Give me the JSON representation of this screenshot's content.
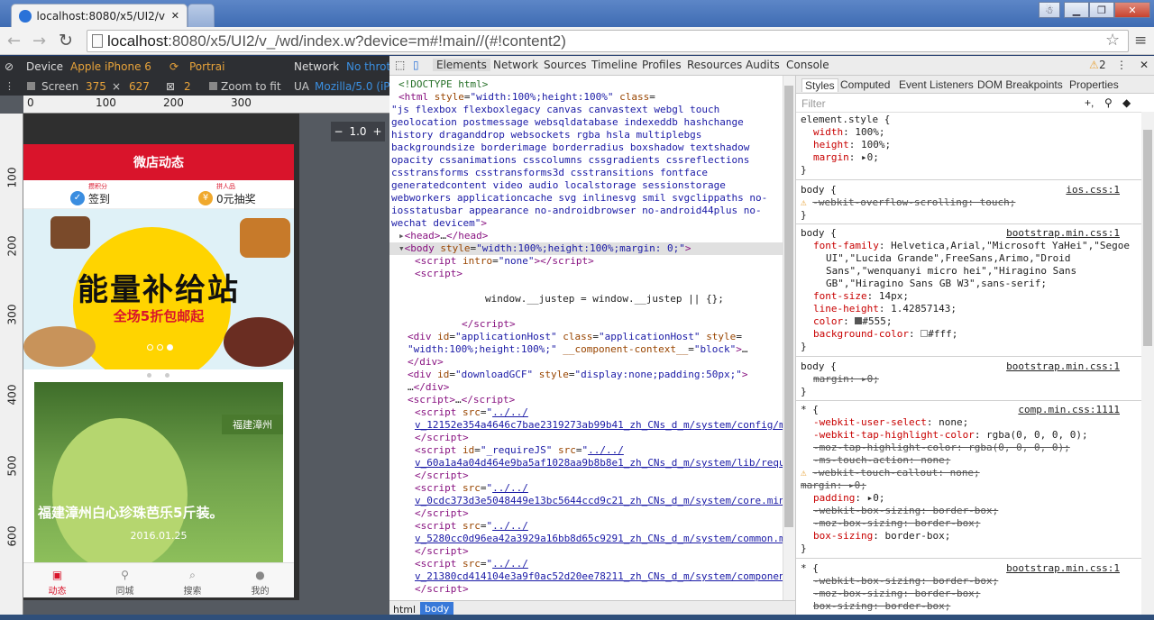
{
  "browser": {
    "tab_title": "localhost:8080/x5/UI2/v",
    "url_host": "localhost",
    "url_rest": ":8080/x5/UI2/v_/wd/index.w?device=m#!main//(#!content2)"
  },
  "emulation": {
    "device_label": "Device",
    "device_value": "Apple iPhone 6",
    "orientation": "Portrai",
    "network_label": "Network",
    "network_value": "No throt",
    "screen_label": "Screen",
    "screen_w": "375",
    "times": "×",
    "screen_h": "627",
    "dpr": "2",
    "zoom_to_fit": "Zoom to fit",
    "ua_label": "UA",
    "ua_value": "Mozilla/5.0 (iPh",
    "zoom": "1.0",
    "zoom_minus": "−",
    "zoom_plus": "+"
  },
  "rulers": {
    "h": [
      "0",
      "100",
      "200",
      "300"
    ],
    "v": [
      "100",
      "200",
      "300",
      "400",
      "500",
      "600"
    ]
  },
  "app": {
    "title": "微店动态",
    "checkin_badge": "攒积分",
    "checkin_label": "签到",
    "lottery_badge": "拼人品",
    "lottery_label": "0元抽奖",
    "banner_main": "能量补给站",
    "banner_sub": "全场5折包邮起",
    "card_tag": "福建漳州",
    "card_title": "福建漳州白心珍珠芭乐5斤装。",
    "card_date": "2016.01.25",
    "nav": [
      "动态",
      "同城",
      "搜索",
      "我的"
    ]
  },
  "devtools": {
    "tabs": [
      "Elements",
      "Network",
      "Sources",
      "Timeline",
      "Profiles",
      "Resources",
      "Audits",
      "Console"
    ],
    "warnings": "2",
    "styles_tabs": [
      "Styles",
      "Computed",
      "Event Listeners",
      "DOM Breakpoints",
      "Properties"
    ],
    "filter_placeholder": "Filter",
    "breadcrumb": [
      "html",
      "body"
    ],
    "html_classes": "js flexbox flexboxlegacy canvas canvastext webgl touch geolocation postmessage websqldatabase indexeddb hashchange history draganddrop websockets rgba hsla multiplebgs backgroundsize borderimage borderradius boxshadow textshadow opacity cssanimations csscolumns cssgradients cssreflections csstransforms csstransforms3d csstransitions fontface generatedcontent video audio localstorage sessionstorage webworkers applicationcache svg inlinesvg smil svgclippaths no-iosstatusbar appearance no-androidbrowser no-android44plus no-wechat devicem",
    "justep_line": "window.__justep = window.__justep || {};",
    "scripts": [
      "v_12152e354a4646c7bae2319273ab99b41_zh_CNs_d_m/system/config/meta.js",
      "v_60a1a4a04d464e9ba5af1028aa9b8b8e1_zh_CNs_d_m/system/lib/require/require.2.1.10.js",
      "v_0cdc373d3e5048449e13bc5644ccd9c21_zh_CNs_d_m/system/core.min.js",
      "v_5280cc0d96ea42a3929a16bb8d65c9291_zh_CNs_d_m/system/common.min.js",
      "v_21380cd414104e3a9f0ac52d20ee78211_zh_CNs_d_m/system/components/comp.min.js"
    ],
    "sources": [
      "ios.css:1",
      "bootstrap.min.css:1",
      "bootstrap.min.css:1",
      "comp.min.css:1111",
      "bootstrap.min.css:1"
    ]
  }
}
